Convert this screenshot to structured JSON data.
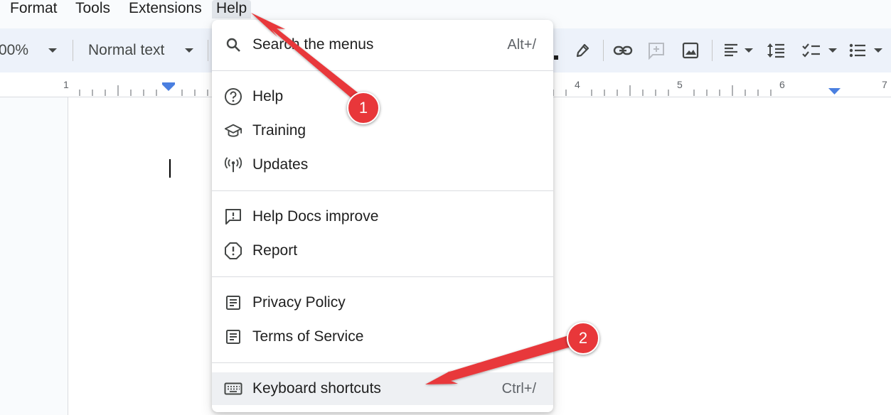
{
  "menubar": {
    "items": [
      {
        "label": "Format"
      },
      {
        "label": "Tools"
      },
      {
        "label": "Extensions"
      },
      {
        "label": "Help"
      }
    ]
  },
  "toolbar": {
    "zoom": "00%",
    "style": "Normal text",
    "icons": [
      "pen-icon",
      "link-icon",
      "add-comment-icon",
      "image-icon",
      "align-left-icon",
      "line-spacing-icon",
      "checklist-icon",
      "bulleted-list-icon"
    ]
  },
  "ruler": {
    "numbers": [
      "1",
      "4",
      "5",
      "6",
      "7"
    ]
  },
  "help_menu": {
    "search": {
      "label": "Search the menus",
      "shortcut": "Alt+/"
    },
    "items": [
      {
        "label": "Help",
        "icon": "help-circle-icon"
      },
      {
        "label": "Training",
        "icon": "graduation-cap-icon"
      },
      {
        "label": "Updates",
        "icon": "broadcast-icon"
      },
      {
        "label": "Help Docs improve",
        "icon": "feedback-icon"
      },
      {
        "label": "Report",
        "icon": "report-icon"
      },
      {
        "label": "Privacy Policy",
        "icon": "document-icon"
      },
      {
        "label": "Terms of Service",
        "icon": "document-icon"
      },
      {
        "label": "Keyboard shortcuts",
        "shortcut": "Ctrl+/",
        "icon": "keyboard-icon"
      }
    ]
  },
  "annotations": {
    "badge_1": "1",
    "badge_2": "2",
    "color": "#e8373a"
  }
}
